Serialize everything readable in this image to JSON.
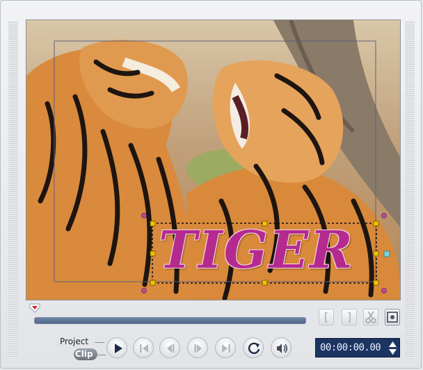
{
  "preview": {
    "overlay_title": "TIGER",
    "title_color": "#b52a8f",
    "title_outline_color": "#f2d8ea"
  },
  "mode": {
    "project_label": "Project",
    "clip_label": "Clip"
  },
  "trim_buttons": {
    "mark_in": "[",
    "mark_out": "]"
  },
  "timecode": {
    "value": "00:00:00.00"
  },
  "icons": [
    "scrub-marker-icon",
    "mark-in-icon",
    "mark-out-icon",
    "split-clip-icon",
    "enlarge-preview-icon",
    "play-icon",
    "home-icon",
    "previous-frame-icon",
    "next-frame-icon",
    "end-icon",
    "repeat-icon",
    "volume-icon",
    "timecode-up-icon",
    "timecode-down-icon"
  ]
}
